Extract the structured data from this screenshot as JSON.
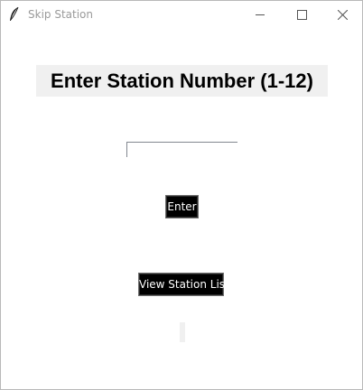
{
  "window": {
    "title": "Skip Station",
    "icon": "feather-icon",
    "controls": [
      "minimize-icon",
      "maximize-icon",
      "close-icon"
    ]
  },
  "main": {
    "heading": "Enter Station Number (1-12)",
    "station_input": {
      "value": "",
      "placeholder": ""
    },
    "enter_label": "Enter",
    "view_list_label": "View Station List",
    "result_text": ""
  },
  "colors": {
    "button_bg": "#000000",
    "button_text": "#ffffff",
    "heading_bg": "#f0f0f0",
    "title_text": "#9a9a9a"
  }
}
